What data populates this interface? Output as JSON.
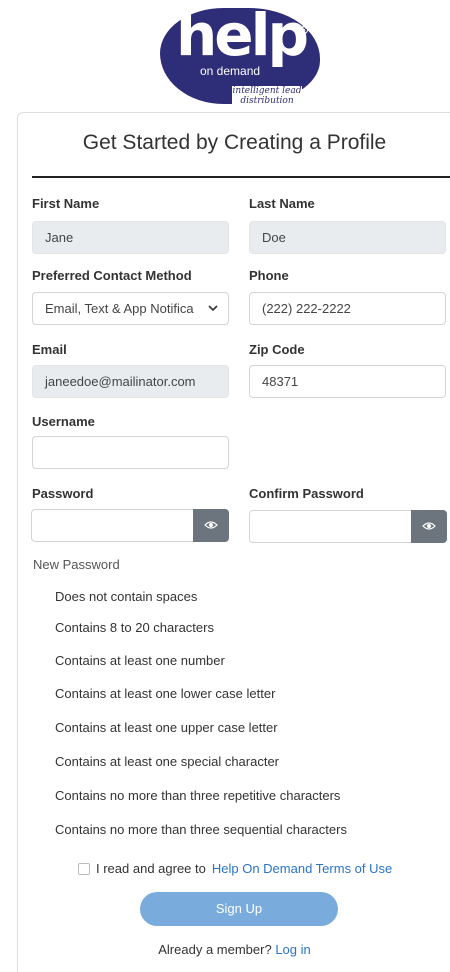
{
  "logo": {
    "word": "help",
    "sub": "on demand",
    "tagline_line1": "intelligent lead",
    "tagline_line2": "distribution"
  },
  "form": {
    "title": "Get Started by Creating a Profile",
    "first_name": {
      "label": "First Name",
      "value": "Jane"
    },
    "last_name": {
      "label": "Last Name",
      "value": "Doe"
    },
    "contact_method": {
      "label": "Preferred Contact Method",
      "value": "Email, Text & App Notifica"
    },
    "phone": {
      "label": "Phone",
      "value": "(222) 222-2222"
    },
    "email": {
      "label": "Email",
      "value": "janeedoe@mailinator.com"
    },
    "zip": {
      "label": "Zip Code",
      "value": "48371"
    },
    "username": {
      "label": "Username",
      "value": ""
    },
    "password": {
      "label": "Password",
      "value": ""
    },
    "confirm_password": {
      "label": "Confirm Password",
      "value": ""
    }
  },
  "password_rules": {
    "title": "New Password",
    "items": [
      "Does not contain spaces",
      "Contains 8 to 20 characters",
      "Contains at least one number",
      "Contains at least one lower case letter",
      "Contains at least one upper case letter",
      "Contains at least one special character",
      "Contains no more than three repetitive characters",
      "Contains no more than three sequential characters"
    ]
  },
  "terms": {
    "prefix": "I read and agree to",
    "link": "Help On Demand Terms of Use"
  },
  "signup_button": "Sign Up",
  "footer": {
    "prefix": "Already a member?",
    "link": "Log in"
  },
  "colors": {
    "brand": "#2e2d78",
    "button": "#79acdc",
    "link": "#2a74c9",
    "eye_button": "#6c757d"
  }
}
